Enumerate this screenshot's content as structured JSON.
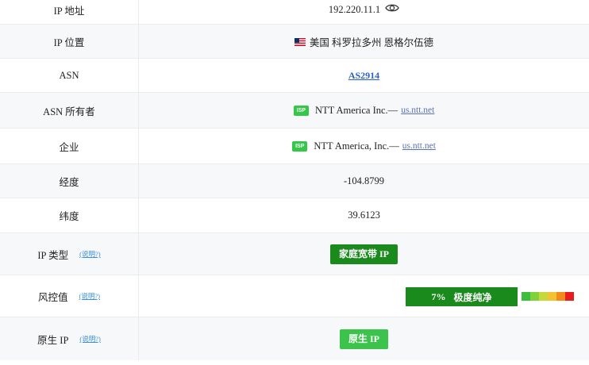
{
  "rows": [
    {
      "label": "IP 地址",
      "value": "192.220.11.1"
    },
    {
      "label": "IP 位置",
      "value": "美国 科罗拉多州 恩格尔伍德"
    },
    {
      "label": "ASN",
      "value": "AS2914"
    },
    {
      "label": "ASN 所有者",
      "badge": "ISP",
      "value": "NTT America Inc.—",
      "link": "us.ntt.net"
    },
    {
      "label": "企业",
      "badge": "ISP",
      "value": "NTT America, Inc.—",
      "link": "us.ntt.net"
    },
    {
      "label": "经度",
      "value": "-104.8799"
    },
    {
      "label": "纬度",
      "value": "39.6123"
    },
    {
      "label": "IP 类型",
      "help": "(说明?)",
      "value": "家庭宽带 IP"
    },
    {
      "label": "风控值",
      "help": "(说明?)",
      "percent": "7%",
      "value": "极度纯净",
      "risk_fraction": 0.07,
      "scale_colors": [
        "#3dbd3d",
        "#7fd23a",
        "#c6d93b",
        "#f2c230",
        "#f28a1c",
        "#e81d1d"
      ]
    },
    {
      "label": "原生 IP",
      "help": "(说明?)",
      "value": "原生 IP"
    }
  ],
  "colors": {
    "badge_dark": "#1a8a1c",
    "badge_light": "#3cc34b",
    "isp_badge": "#35c64a",
    "link": "#2b5ec9",
    "help": "#3a8fd6"
  },
  "icons": {
    "eye": "eye-icon",
    "flag": "us-flag-icon"
  }
}
